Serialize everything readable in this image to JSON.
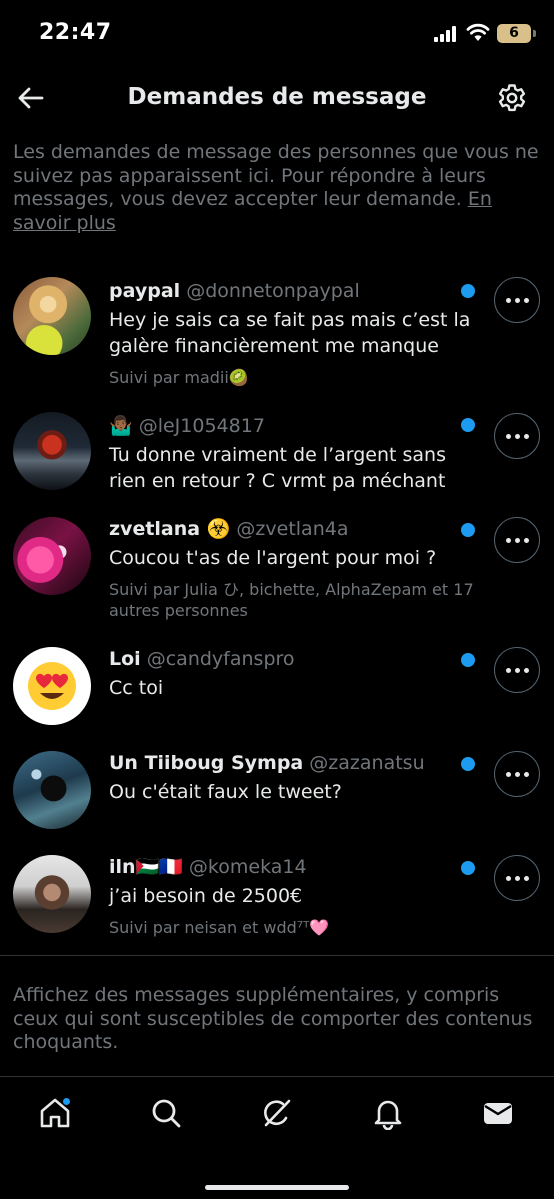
{
  "status_bar": {
    "time": "22:47",
    "battery": "6"
  },
  "header": {
    "title": "Demandes de message"
  },
  "info": {
    "text": "Les demandes de message des personnes que vous ne suivez pas apparaissent ici. Pour répondre à leurs messages, vous devez accepter leur demande. ",
    "link": "En savoir plus"
  },
  "requests": [
    {
      "name": "paypal",
      "handle": "@donnetonpaypal",
      "message": "Hey je sais ca se fait pas mais c’est la galère financièrement me manque",
      "followed": "Suivi par madii🥝",
      "unread": true
    },
    {
      "name": "🤷🏾‍♂️",
      "handle": "@leJ1054817",
      "message": "Tu donne vraiment de l’argent sans rien en retour ? C vrmt pa méchant",
      "followed": "",
      "unread": true
    },
    {
      "name": "zvetlana ☣️",
      "handle": "@zvetlan4a",
      "message": "Coucou t'as de l'argent pour moi ?",
      "followed": "Suivi par Julia ひ, bichette, AlphaZepam et 17 autres personnes",
      "unread": true
    },
    {
      "name": "Loi",
      "handle": "@candyfanspro",
      "message": "Cc toi",
      "followed": "",
      "unread": true
    },
    {
      "name": "Un Tiiboug Sympa",
      "handle": "@zazanatsu",
      "message": "Ou c'était faux le tweet?",
      "followed": "",
      "unread": true
    },
    {
      "name": "iln🇵🇸🇫🇷",
      "handle": "@komeka14",
      "message": "j’ai besoin de 2500€",
      "followed": "Suivi par neisan et wdd⁷ᵀ🩷",
      "unread": true
    }
  ],
  "more_messages": "Affichez des messages supplémentaires, y compris ceux qui sont susceptibles de comporter des contenus choquants.",
  "tabbar": {
    "tabs": [
      {
        "icon": "home-icon",
        "has_badge": true
      },
      {
        "icon": "search-icon",
        "has_badge": false
      },
      {
        "icon": "grok-icon",
        "has_badge": false
      },
      {
        "icon": "bell-icon",
        "has_badge": false
      },
      {
        "icon": "mail-icon",
        "has_badge": false
      }
    ]
  },
  "colors": {
    "accent": "#1d9bf0",
    "background": "#000000",
    "secondary_text": "#71767b",
    "primary_text": "#e7e9ea"
  }
}
